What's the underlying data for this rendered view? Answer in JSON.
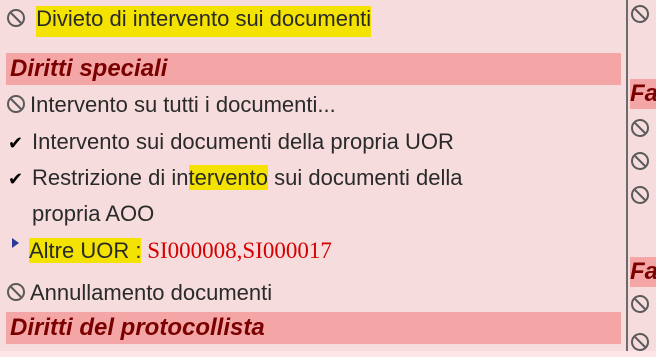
{
  "left_panel": {
    "item_divieto": {
      "label": "Divieto di intervento sui documenti"
    },
    "section_diritti_speciali": {
      "label": "Diritti speciali"
    },
    "item_intervento_tutti": {
      "label": "Intervento su tutti i documenti..."
    },
    "item_propria_uor": {
      "label": "Intervento sui documenti della propria UOR"
    },
    "item_restrizione": {
      "label_part1": "Restrizione di in",
      "label_highlight": "tervento",
      "label_part2": " sui documenti della",
      "label_line2": "propria AOO"
    },
    "item_altre_uor": {
      "label": "Altre UOR :",
      "value": " SI000008,SI000017"
    },
    "item_annullamento": {
      "label": "Annullamento documenti"
    },
    "section_protocollista": {
      "label": "Diritti del protocollista"
    }
  },
  "right_panel": {
    "section_fragment_1": "Fa",
    "section_fragment_2": "Fa"
  }
}
